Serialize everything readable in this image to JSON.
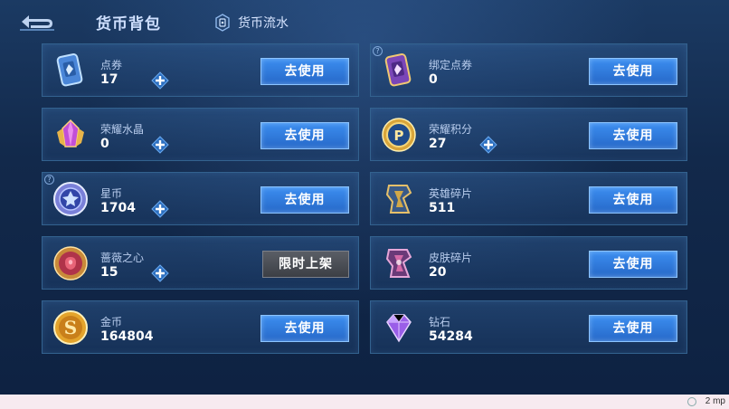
{
  "header": {
    "title": "货币背包",
    "flow_tab": "货币流水"
  },
  "currencies": [
    {
      "name": "点券",
      "amount": "17",
      "button": "去使用",
      "icon": "voucher-card-icon"
    },
    {
      "name": "绑定点券",
      "amount": "0",
      "button": "去使用",
      "icon": "bound-voucher-card-icon"
    },
    {
      "name": "荣耀水晶",
      "amount": "0",
      "button": "去使用",
      "icon": "glory-crystal-icon"
    },
    {
      "name": "荣耀积分",
      "amount": "27",
      "button": "去使用",
      "icon": "glory-points-coin-icon"
    },
    {
      "name": "星币",
      "amount": "1704",
      "button": "去使用",
      "icon": "star-coin-icon"
    },
    {
      "name": "英雄碎片",
      "amount": "511",
      "button": "去使用",
      "icon": "hero-fragment-icon"
    },
    {
      "name": "蔷薇之心",
      "amount": "15",
      "button": "限时上架",
      "icon": "rose-heart-icon"
    },
    {
      "name": "皮肤碎片",
      "amount": "20",
      "button": "去使用",
      "icon": "skin-fragment-icon"
    },
    {
      "name": "金币",
      "amount": "164804",
      "button": "去使用",
      "icon": "gold-coin-icon"
    },
    {
      "name": "钻石",
      "amount": "54284",
      "button": "去使用",
      "icon": "diamond-icon"
    }
  ],
  "footer": {
    "text": "2 mp"
  },
  "colors": {
    "use_button": "#2f7ae0",
    "limited_button": "#4a4e55",
    "card_border": "#33628f"
  }
}
